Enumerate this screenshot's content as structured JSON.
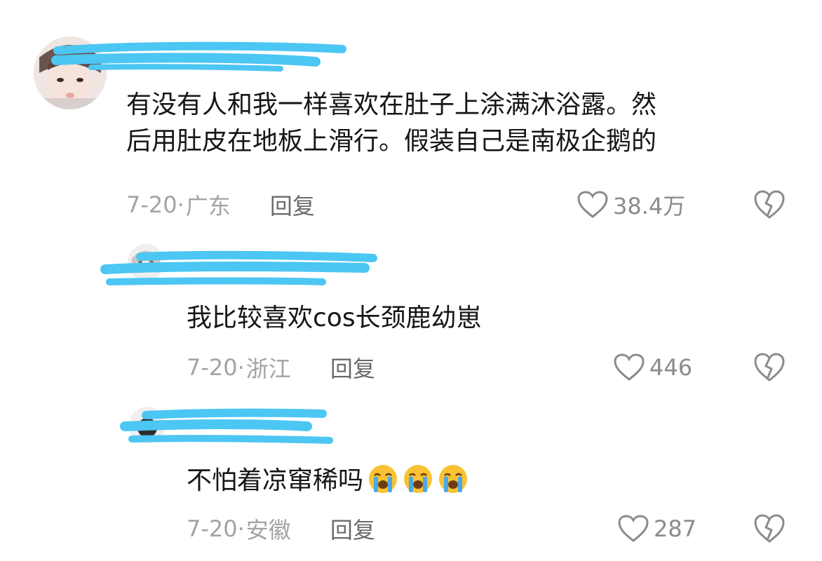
{
  "comments": [
    {
      "text_lines": [
        "有没有人和我一样喜欢在肚子上涂满沐浴露。然",
        "后用肚皮在地板上滑行。假装自己是南极企鹅的"
      ],
      "date": "7-20·",
      "region": "广东",
      "reply_label": "回复",
      "likes": "38.4万"
    },
    {
      "text": "我比较喜欢cos长颈鹿幼崽",
      "date": "7-20·",
      "region": "浙江",
      "reply_label": "回复",
      "likes": "446"
    },
    {
      "text": "不怕着凉窜稀吗",
      "emoji_count": 3,
      "emoji": "loudly-crying-face",
      "date": "7-20·",
      "region": "安徽",
      "reply_label": "回复",
      "likes": "287"
    }
  ],
  "colors": {
    "redaction": "#4cc6f3",
    "text": "#161616",
    "meta": "#a3a3a3",
    "icon": "#8b8b8b"
  }
}
